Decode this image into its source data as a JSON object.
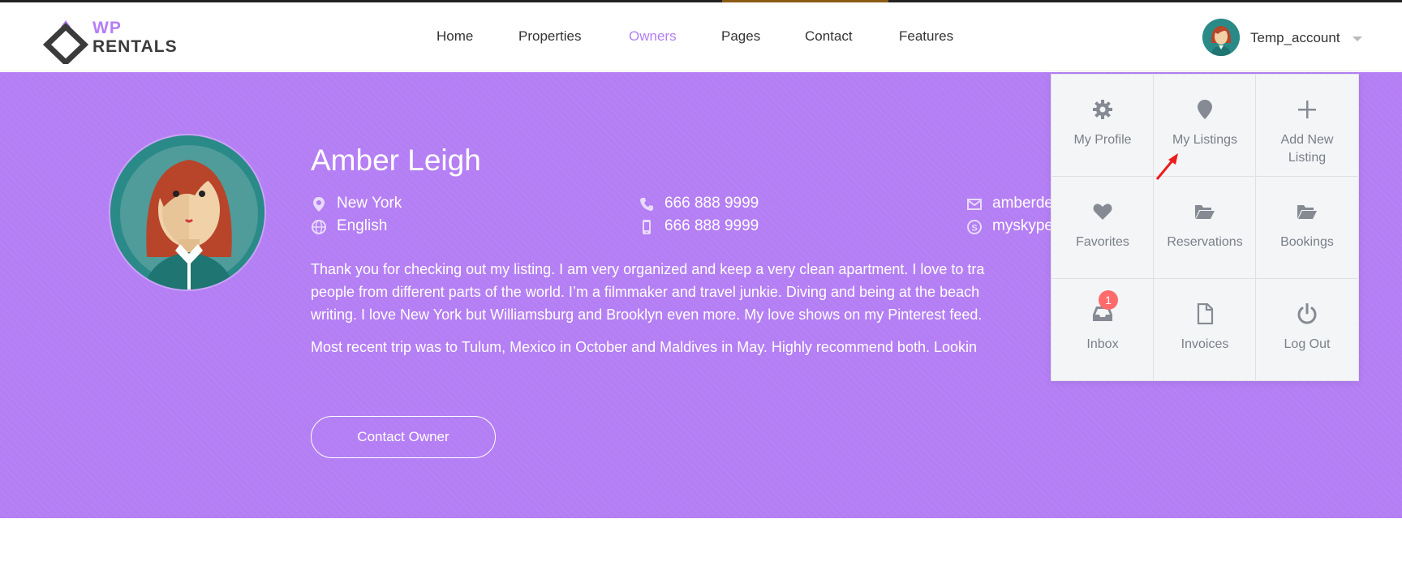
{
  "brand": {
    "line1": "WP",
    "line2": "RENTALS"
  },
  "nav": {
    "home": "Home",
    "properties": "Properties",
    "owners": "Owners",
    "pages": "Pages",
    "contact": "Contact",
    "features": "Features"
  },
  "account": {
    "username": "Temp_account"
  },
  "profile": {
    "name": "Amber Leigh",
    "location": "New York",
    "language": "English",
    "phone": "666 888 9999",
    "mobile": "666 888 9999",
    "email": "amberde",
    "skype": "myskype",
    "bio_1": "Thank you for checking out my listing. I am very organized and keep a very clean apartment. I love to tra",
    "bio_2": "people from different parts of the world. I’m a filmmaker and travel junkie. Diving and being at the beach",
    "bio_3": "writing. I love New York but Williamsburg and Brooklyn even more. My love shows on my Pinterest feed.",
    "bio_4": "Most recent trip was to Tulum, Mexico in October and Maldives in May. Highly recommend both. Lookin",
    "contact_button": "Contact Owner"
  },
  "menu": {
    "my_profile": "My Profile",
    "my_listings": "My Listings",
    "add_new_listing_1": "Add New",
    "add_new_listing_2": "Listing",
    "favorites": "Favorites",
    "reservations": "Reservations",
    "bookings": "Bookings",
    "inbox": "Inbox",
    "inbox_badge": "1",
    "invoices": "Invoices",
    "log_out": "Log Out"
  },
  "colors": {
    "accent": "#b57ef3",
    "hero": "#b47ef4",
    "badge": "#ff6b6b"
  }
}
